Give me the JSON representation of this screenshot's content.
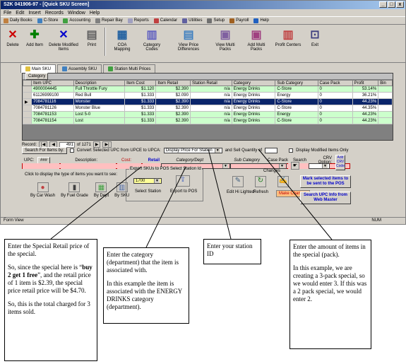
{
  "window": {
    "title": "S2K 041906-97 - [Quick SKU Screen]",
    "controls": [
      "_",
      "□",
      "x"
    ]
  },
  "menu": [
    "File",
    "Edit",
    "Insert",
    "Records",
    "Window",
    "Help"
  ],
  "quickbar": [
    "Daily Books",
    "C-Store",
    "Accounting",
    "Repair Bay",
    "Reports",
    "Calendar",
    "Utilities",
    "Setup",
    "Payroll",
    "Help"
  ],
  "toolbar": [
    {
      "label": "Delete",
      "icon": "delete-x-icon",
      "color": "#cc0000"
    },
    {
      "label": "Add Item",
      "icon": "add-plus-icon",
      "color": "#008000"
    },
    {
      "label": "Delete Modified Items",
      "icon": "delete-modified-icon",
      "color": "#0000cc"
    },
    {
      "label": "Print",
      "icon": "printer-icon",
      "color": "#606060"
    },
    {
      "label": "COA Mapping",
      "icon": "coa-mapping-icon",
      "color": "#2060a0"
    },
    {
      "label": "Category Codes",
      "icon": "category-codes-icon",
      "color": "#6060c0"
    },
    {
      "label": "View Price Differences",
      "icon": "price-diff-icon",
      "color": "#4080c0"
    },
    {
      "label": "View Multi Packs",
      "icon": "view-multipack-icon",
      "color": "#8060a0"
    },
    {
      "label": "Add Multi Packs",
      "icon": "add-multipack-icon",
      "color": "#a04080"
    },
    {
      "label": "Profit Centers",
      "icon": "profit-centers-icon",
      "color": "#c04040"
    },
    {
      "label": "Exit",
      "icon": "exit-icon",
      "color": "#404080"
    }
  ],
  "tabs": [
    "Main SKU",
    "Assembly SKU",
    "Station Multi Prices"
  ],
  "grid": {
    "group_label": "Category",
    "columns": [
      "Item UPC",
      "Description",
      "Item Cost",
      "Item Retail",
      "Station Retail",
      "Category",
      "Sub Category",
      "Case Pack",
      "Profit",
      "Bin"
    ],
    "rows": [
      {
        "upc": "4900004445",
        "desc": "Full Throttle Fury",
        "cost": "$1.120",
        "retail": "$2.390",
        "station": "n/a",
        "cat": "Energy Drinks",
        "sub": "C-Store",
        "pack": "0",
        "profit": "53.14%",
        "bin": "",
        "style": "r-green"
      },
      {
        "upc": "61126999100",
        "desc": "Red Bull",
        "cost": "$1.333",
        "retail": "$2.090",
        "station": "n/a",
        "cat": "Energy Drinks",
        "sub": "Energy",
        "pack": "0",
        "profit": "36.21%",
        "bin": "",
        "style": "r-white"
      },
      {
        "upc": "7084781116",
        "desc": "Monster",
        "cost": "$1.333",
        "retail": "$2.390",
        "station": "n/a",
        "cat": "Energy Drinks",
        "sub": "C-Store",
        "pack": "0",
        "profit": "44.23%",
        "bin": "",
        "style": "r-sel"
      },
      {
        "upc": "7084781126",
        "desc": "Monster Blue",
        "cost": "$1.333",
        "retail": "$2.390",
        "station": "n/a",
        "cat": "Energy Drinks",
        "sub": "C-Store",
        "pack": "0",
        "profit": "44.35%",
        "bin": "",
        "style": "r-white"
      },
      {
        "upc": "7084781153",
        "desc": "Lost 5-0",
        "cost": "$1.333",
        "retail": "$2.390",
        "station": "n/a",
        "cat": "Energy Drinks",
        "sub": "Energy",
        "pack": "0",
        "profit": "44.23%",
        "bin": "",
        "style": "r-green"
      },
      {
        "upc": "7084781154",
        "desc": "Lost",
        "cost": "$1.333",
        "retail": "$2.390",
        "station": "n/a",
        "cat": "Energy Drinks",
        "sub": "C-Store",
        "pack": "0",
        "profit": "44.23%",
        "bin": "",
        "style": "r-green"
      }
    ]
  },
  "record_nav": {
    "label": "Record:",
    "current": "491",
    "total": "of 1271"
  },
  "search": {
    "label": "Search For Items by:",
    "convert_label": "Convert Selected UPC from UPCE to UPCA:",
    "display_price": "Display Price For Station",
    "and_sell": "and Sell Quantity of",
    "display_modified": "Display Modified Items Only",
    "fields": [
      "UPC:",
      "Description:",
      "Cost:",
      "Retail",
      "Category/Dept",
      "Sub Category",
      "Case Pack",
      "Search",
      "CRV Option:"
    ],
    "add_crv": "Add CRV Code"
  },
  "filters": {
    "hint": "Click to display the type of items you want to see:",
    "items": [
      "By Car Wash",
      "By Fuel Grade",
      "By Dept",
      "By SKU"
    ]
  },
  "export": {
    "group_title": "Export SKUs to POS Select Station Id",
    "station_value": "1700",
    "select_label": "Select Station",
    "export_label": "Export to POS"
  },
  "changes": {
    "title": "Changes",
    "edit_hl": "Edit Hi Lighted",
    "refresh": "Refresh",
    "make": "Make Changes"
  },
  "right_buttons": {
    "mark": "Mark selected items to be sent to the POS",
    "search_upc": "Search UPC Info from Web Master"
  },
  "status": {
    "left": "Form View",
    "num": "NUM"
  },
  "callouts": {
    "c1": {
      "p1": "Enter the Special Retail price of the special.",
      "p2a": "So, since the special here is “",
      "p2b": "buy 2 get 1 free",
      "p2c": "”, and the retail price of 1 item is $2.39, the special price retail price will be $4.70.",
      "p3": "So, this is the total charged for 3 items sold."
    },
    "c2": {
      "p1": "Enter the category (department) that the item is associated with.",
      "p2": "In this example the item is associated with the ENERGY DRINKS category (department)."
    },
    "c3": {
      "p1": "Enter your station ID"
    },
    "c4": {
      "p1": "Enter the amount of items in the special (pack).",
      "p2": "In this example, we are creating a 3-pack special, so we would enter 3.  If this was a 2 pack special, we would enter 2."
    }
  }
}
